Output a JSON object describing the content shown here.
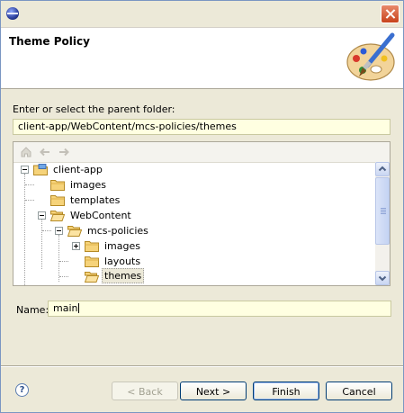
{
  "window": {
    "close_icon": "close-icon"
  },
  "header": {
    "title": "Theme Policy",
    "banner_icon": "palette-brush-icon"
  },
  "folder_section": {
    "label": "Enter or select the parent folder:",
    "path_value": "client-app/WebContent/mcs-policies/themes"
  },
  "tree_toolbar": {
    "icons": [
      "home-icon",
      "back-arrow-icon",
      "forward-arrow-icon"
    ]
  },
  "tree": {
    "items": [
      {
        "label": "client-app",
        "level": 0,
        "expander": "minus",
        "icon": "project-folder-icon"
      },
      {
        "label": "images",
        "level": 1,
        "expander": "none",
        "icon": "folder-icon"
      },
      {
        "label": "templates",
        "level": 1,
        "expander": "none",
        "icon": "folder-icon"
      },
      {
        "label": "WebContent",
        "level": 1,
        "expander": "minus",
        "icon": "folder-open-icon"
      },
      {
        "label": "mcs-policies",
        "level": 2,
        "expander": "minus",
        "icon": "folder-open-icon"
      },
      {
        "label": "images",
        "level": 3,
        "expander": "plus",
        "icon": "folder-icon"
      },
      {
        "label": "layouts",
        "level": 3,
        "expander": "none",
        "icon": "folder-icon"
      },
      {
        "label": "themes",
        "level": 3,
        "expander": "none",
        "icon": "folder-open-icon",
        "selected": true
      }
    ]
  },
  "name_field": {
    "label": "Name:",
    "value": "main"
  },
  "buttons": {
    "back": "< Back",
    "next": "Next >",
    "finish": "Finish",
    "cancel": "Cancel"
  },
  "help": {
    "symbol": "?"
  },
  "colors": {
    "input_background": "#ffffe1",
    "dialog_background": "#ece9d8",
    "button_border": "#003c74"
  }
}
